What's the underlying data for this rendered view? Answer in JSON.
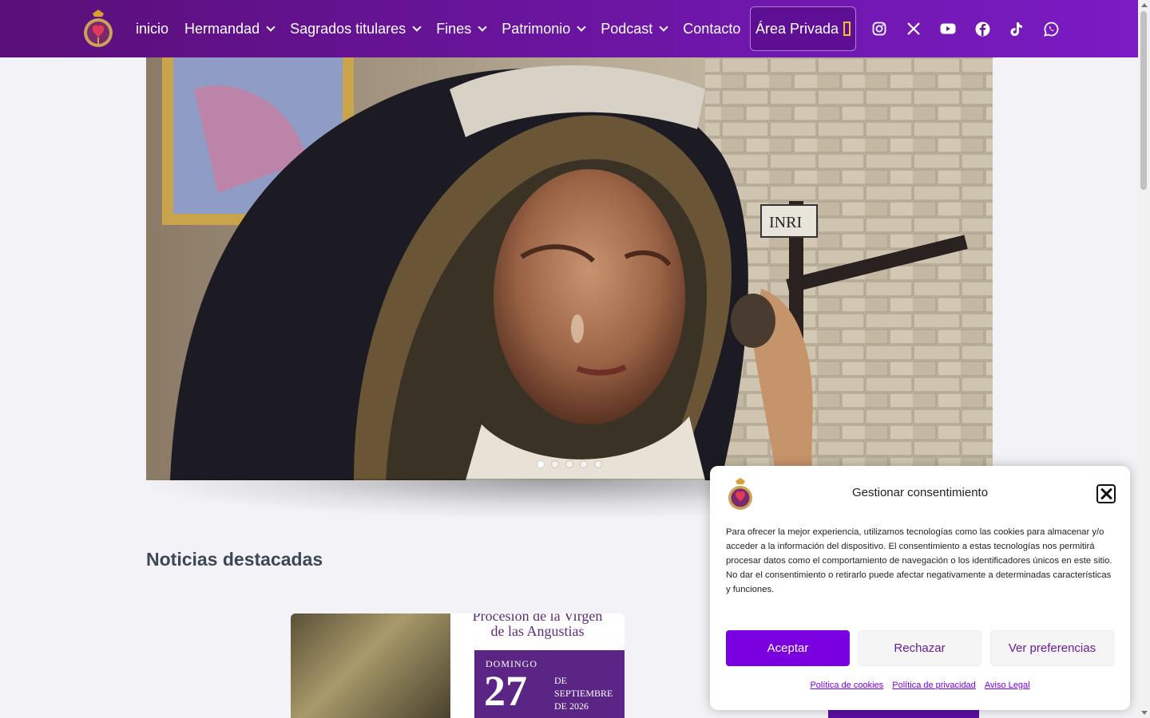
{
  "header": {
    "menu": [
      {
        "label": "inicio",
        "has_dropdown": false
      },
      {
        "label": "Hermandad",
        "has_dropdown": true
      },
      {
        "label": "Sagrados titulares",
        "has_dropdown": true
      },
      {
        "label": "Fines",
        "has_dropdown": true
      },
      {
        "label": "Patrimonio",
        "has_dropdown": true
      },
      {
        "label": "Podcast",
        "has_dropdown": true
      },
      {
        "label": "Contacto",
        "has_dropdown": false
      }
    ],
    "private_area_label": "Área Privada",
    "social_icons": [
      "instagram-icon",
      "x-twitter-icon",
      "youtube-icon",
      "facebook-icon",
      "tiktok-icon",
      "whatsapp-icon"
    ],
    "colors": {
      "bar_start": "#5a0f78",
      "bar_end": "#7a1bc4",
      "accent": "#7a00df"
    }
  },
  "hero": {
    "slides_count": 5,
    "active_slide": 1,
    "sign_text": "INRI"
  },
  "main": {
    "section_title": "Noticias destacadas",
    "news_card": {
      "poster_title_line1": "Procesión de la Virgen",
      "poster_title_line2": "de las Angustias",
      "day_label": "DOMINGO",
      "day_number": "27",
      "date_line1": "DE",
      "date_line2": "SEPTIEMBRE",
      "date_line3": "DE 2026"
    }
  },
  "cookie_dialog": {
    "title": "Gestionar consentimiento",
    "text": "Para ofrecer la mejor experiencia, utilizamos tecnologías como las cookies para almacenar y/o acceder a la información del dispositivo. El consentimiento a estas tecnologías nos permitirá procesar datos como el comportamiento de navegación o los identificadores únicos en este sitio. No dar el consentimiento o retirarlo puede afectar negativamente a determinadas características y funciones.",
    "accept_label": "Aceptar",
    "reject_label": "Rechazar",
    "preferences_label": "Ver preferencias",
    "links": [
      "Política de cookies",
      "Política de privacidad",
      "Aviso Legal"
    ]
  }
}
